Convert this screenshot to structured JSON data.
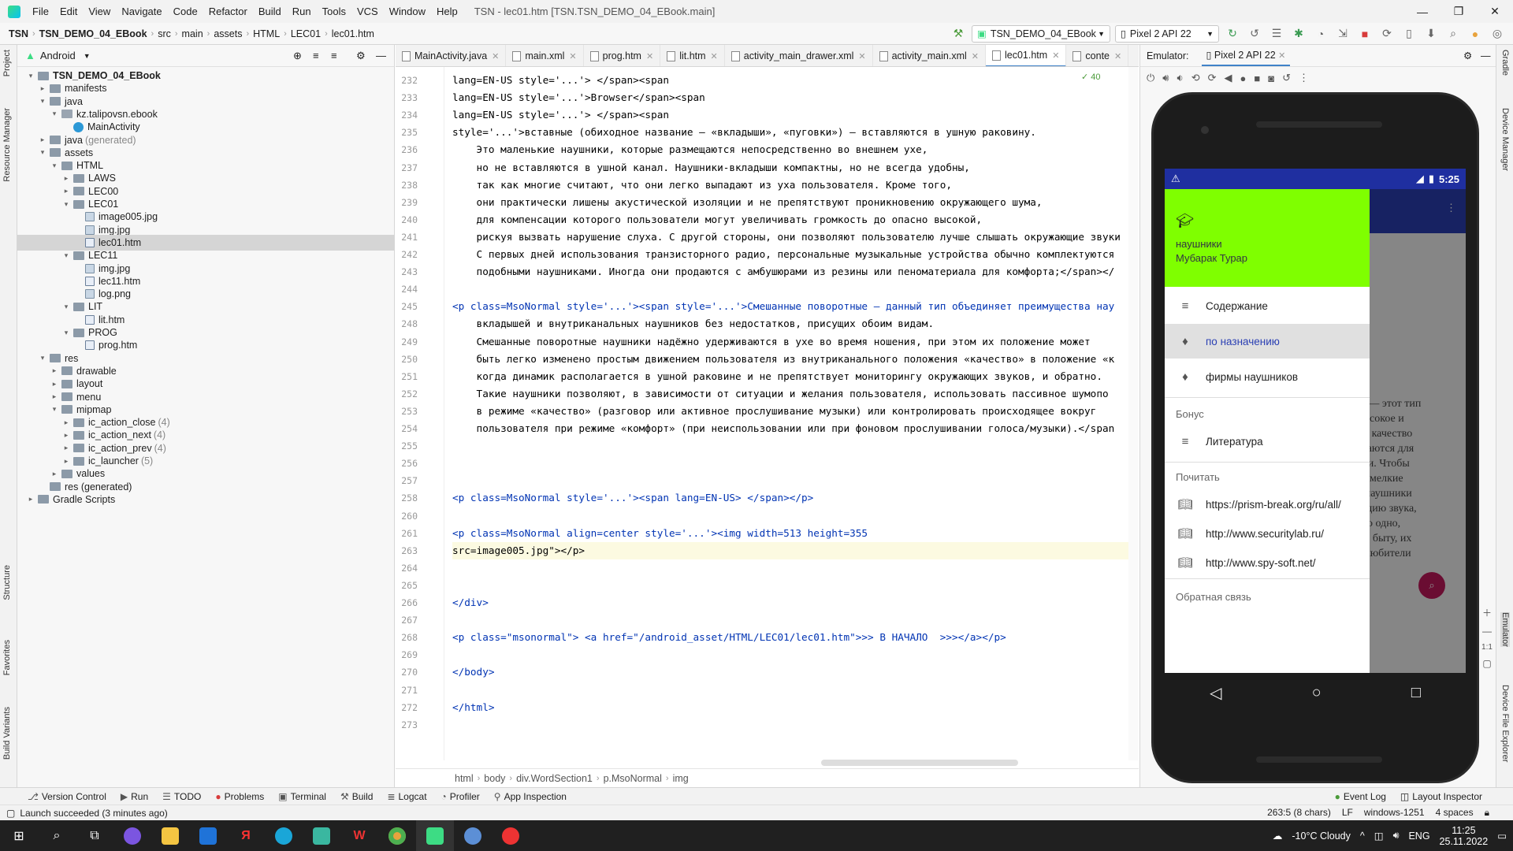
{
  "menubar": {
    "items": [
      "File",
      "Edit",
      "View",
      "Navigate",
      "Code",
      "Refactor",
      "Build",
      "Run",
      "Tools",
      "VCS",
      "Window",
      "Help"
    ],
    "title": "TSN - lec01.htm [TSN.TSN_DEMO_04_EBook.main]"
  },
  "nav": {
    "crumbs": [
      "TSN",
      "TSN_DEMO_04_EBook",
      "src",
      "main",
      "assets",
      "HTML",
      "LEC01",
      "lec01.htm"
    ],
    "run_config": "TSN_DEMO_04_EBook",
    "device": "Pixel 2 API 22"
  },
  "project": {
    "view": "Android",
    "tree": [
      {
        "label": "TSN_DEMO_04_EBook",
        "bold": true,
        "indent": 0,
        "arrow": "▾",
        "icon": "fico"
      },
      {
        "label": "manifests",
        "indent": 1,
        "arrow": "▸",
        "icon": "fico"
      },
      {
        "label": "java",
        "indent": 1,
        "arrow": "▾",
        "icon": "fico"
      },
      {
        "label": "kz.talipovsn.ebook",
        "indent": 2,
        "arrow": "▾",
        "icon": "fico pkg"
      },
      {
        "label": "MainActivity",
        "indent": 3,
        "arrow": "",
        "icon": "fico cls"
      },
      {
        "label": "java",
        "sub": "(generated)",
        "indent": 1,
        "arrow": "▸",
        "icon": "fico"
      },
      {
        "label": "assets",
        "indent": 1,
        "arrow": "▾",
        "icon": "fico"
      },
      {
        "label": "HTML",
        "indent": 2,
        "arrow": "▾",
        "icon": "fico"
      },
      {
        "label": "LAWS",
        "indent": 3,
        "arrow": "▸",
        "icon": "fico"
      },
      {
        "label": "LEC00",
        "indent": 3,
        "arrow": "▸",
        "icon": "fico"
      },
      {
        "label": "LEC01",
        "indent": 3,
        "arrow": "▾",
        "icon": "fico"
      },
      {
        "label": "image005.jpg",
        "indent": 4,
        "arrow": "",
        "icon": "fico img"
      },
      {
        "label": "img.jpg",
        "indent": 4,
        "arrow": "",
        "icon": "fico img"
      },
      {
        "label": "lec01.htm",
        "indent": 4,
        "arrow": "",
        "icon": "fico htm",
        "sel": true
      },
      {
        "label": "LEC11",
        "indent": 3,
        "arrow": "▾",
        "icon": "fico"
      },
      {
        "label": "img.jpg",
        "indent": 4,
        "arrow": "",
        "icon": "fico img"
      },
      {
        "label": "lec11.htm",
        "indent": 4,
        "arrow": "",
        "icon": "fico htm"
      },
      {
        "label": "log.png",
        "indent": 4,
        "arrow": "",
        "icon": "fico img"
      },
      {
        "label": "LIT",
        "indent": 3,
        "arrow": "▾",
        "icon": "fico"
      },
      {
        "label": "lit.htm",
        "indent": 4,
        "arrow": "",
        "icon": "fico htm"
      },
      {
        "label": "PROG",
        "indent": 3,
        "arrow": "▾",
        "icon": "fico"
      },
      {
        "label": "prog.htm",
        "indent": 4,
        "arrow": "",
        "icon": "fico htm"
      },
      {
        "label": "res",
        "indent": 1,
        "arrow": "▾",
        "icon": "fico"
      },
      {
        "label": "drawable",
        "indent": 2,
        "arrow": "▸",
        "icon": "fico"
      },
      {
        "label": "layout",
        "indent": 2,
        "arrow": "▸",
        "icon": "fico"
      },
      {
        "label": "menu",
        "indent": 2,
        "arrow": "▸",
        "icon": "fico"
      },
      {
        "label": "mipmap",
        "indent": 2,
        "arrow": "▾",
        "icon": "fico"
      },
      {
        "label": "ic_action_close",
        "sub": "(4)",
        "indent": 3,
        "arrow": "▸",
        "icon": "fico"
      },
      {
        "label": "ic_action_next",
        "sub": "(4)",
        "indent": 3,
        "arrow": "▸",
        "icon": "fico"
      },
      {
        "label": "ic_action_prev",
        "sub": "(4)",
        "indent": 3,
        "arrow": "▸",
        "icon": "fico"
      },
      {
        "label": "ic_launcher",
        "sub": "(5)",
        "indent": 3,
        "arrow": "▸",
        "icon": "fico"
      },
      {
        "label": "values",
        "indent": 2,
        "arrow": "▸",
        "icon": "fico"
      },
      {
        "label": "res (generated)",
        "indent": 1,
        "arrow": "",
        "icon": "fico"
      },
      {
        "label": "Gradle Scripts",
        "indent": 0,
        "arrow": "▸",
        "icon": "fico"
      }
    ]
  },
  "tabs": [
    "MainActivity.java",
    "main.xml",
    "prog.htm",
    "lit.htm",
    "activity_main_drawer.xml",
    "activity_main.xml",
    "lec01.htm",
    "conte"
  ],
  "active_tab": "lec01.htm",
  "code": [
    {
      "n": "232",
      "t": "lang=EN-US style='...'> </span><span"
    },
    {
      "n": "233",
      "t": "lang=EN-US style='...'>Browser</span><span"
    },
    {
      "n": "234",
      "t": "lang=EN-US style='...'> </span><span"
    },
    {
      "n": "235",
      "t": "style='...'>вставные (обиходное название — «вкладыши», «пуговки») — вставляются в ушную раковину."
    },
    {
      "n": "236",
      "t": "    Это маленькие наушники, которые размещаются непосредственно во внешнем ухе,"
    },
    {
      "n": "237",
      "t": "    но не вставляются в ушной канал. Наушники-вкладыши компактны, но не всегда удобны,"
    },
    {
      "n": "238",
      "t": "    так как многие считают, что они легко выпадают из уха пользователя. Кроме того,"
    },
    {
      "n": "239",
      "t": "    они практически лишены акустической изоляции и не препятствуют проникновению окружающего шума,"
    },
    {
      "n": "240",
      "t": "    для компенсации которого пользователи могут увеличивать громкость до опасно высокой,"
    },
    {
      "n": "241",
      "t": "    рискуя вызвать нарушение слуха. С другой стороны, они позволяют пользователю лучше слышать окружающие звуки"
    },
    {
      "n": "242",
      "t": "    С первых дней использования транзисторного радио, персональные музыкальные устройства обычно комплектуются"
    },
    {
      "n": "243",
      "t": "    подобными наушниками. Иногда они продаются с амбушюрами из резины или пеноматериала для комфорта;</span></"
    },
    {
      "n": "244",
      "t": ""
    },
    {
      "n": "245",
      "t": "<p class=MsoNormal style='...'><span style='...'>Смешанные поворотные — данный тип объединяет преимущества нау"
    },
    {
      "n": "248",
      "t": "    вкладышей и внутриканальных наушников без недостатков, присущих обоим видам."
    },
    {
      "n": "249",
      "t": "    Смешанные поворотные наушники надёжно удерживаются в ухе во время ношения, при этом их положение может"
    },
    {
      "n": "250",
      "t": "    быть легко изменено простым движением пользователя из внутриканального положения «качество» в положение «к"
    },
    {
      "n": "251",
      "t": "    когда динамик располагается в ушной раковине и не препятствует мониторингу окружающих звуков, и обратно."
    },
    {
      "n": "252",
      "t": "    Такие наушники позволяют, в зависимости от ситуации и желания пользователя, использовать пассивное шумопо"
    },
    {
      "n": "253",
      "t": "    в режиме «качество» (разговор или активное прослушивание музыки) или контролировать происходящее вокруг"
    },
    {
      "n": "254",
      "t": "    пользователя при режиме «комфорт» (при неиспользовании или при фоновом прослушивании голоса/музыки).</span"
    },
    {
      "n": "255",
      "t": ""
    },
    {
      "n": "256",
      "t": ""
    },
    {
      "n": "257",
      "t": ""
    },
    {
      "n": "258",
      "t": "<p class=MsoNormal style='...'><span lang=EN-US> </span></p>"
    },
    {
      "n": "260",
      "t": ""
    },
    {
      "n": "261",
      "t": "<p class=MsoNormal align=center style='...'><img width=513 height=355"
    },
    {
      "n": "263",
      "t": "src=image005.jpg\"></p>"
    },
    {
      "n": "264",
      "t": ""
    },
    {
      "n": "265",
      "t": ""
    },
    {
      "n": "266",
      "t": "</div>"
    },
    {
      "n": "267",
      "t": ""
    },
    {
      "n": "268",
      "t": "<p class=\"msonormal\"> <a href=\"/android_asset/HTML/LEC01/lec01.htm\">>> В НАЧАЛО  >>></a></p>"
    },
    {
      "n": "269",
      "t": ""
    },
    {
      "n": "270",
      "t": "</body>"
    },
    {
      "n": "271",
      "t": ""
    },
    {
      "n": "272",
      "t": "</html>"
    },
    {
      "n": "273",
      "t": ""
    }
  ],
  "inspection_count": "40",
  "editor_breadcrumb": [
    "html",
    "body",
    "div.WordSection1",
    "p.MsoNormal",
    "img"
  ],
  "emulator": {
    "label": "Emulator:",
    "tab": "Pixel 2 API 22",
    "clock": "5:25",
    "drawer": {
      "title": "наушники",
      "subtitle": "Мубарак Турар",
      "items": [
        {
          "label": "Содержание",
          "icon": "≡",
          "active": false
        },
        {
          "label": "по назначению",
          "icon": "♦",
          "active": true
        },
        {
          "label": "фирмы наушников",
          "icon": "♦",
          "active": false
        }
      ],
      "cap1": "Бонус",
      "lit": "Литература",
      "cap2": "Почитать",
      "links": [
        "https://prism-break.org/ru/all/",
        "http://www.securitylab.ru/",
        "http://www.spy-soft.net/"
      ],
      "cap3": "Обратная связь"
    },
    "bgtext": [
      "о",
      "е) — этот тип",
      "высокое   и",
      "ам качество",
      "ачаются для",
      "иси. Чтобы",
      "ть  мелкие",
      "е наушники",
      "зацию звука,",
      "что одно,",
      "е в быту, их",
      "е любители"
    ],
    "zoom": "1:1"
  },
  "bottombar": [
    "Version Control",
    "Run",
    "TODO",
    "Problems",
    "Terminal",
    "Build",
    "Logcat",
    "Profiler",
    "App Inspection"
  ],
  "bottom_right": [
    "Event Log",
    "Layout Inspector"
  ],
  "status": {
    "message": "Launch succeeded (3 minutes ago)",
    "position": "263:5 (8 chars)",
    "lf": "LF",
    "encoding": "windows-1251",
    "indent": "4 spaces"
  },
  "taskbar": {
    "weather": "-10°C  Cloudy",
    "lang": "ENG",
    "time": "11:25",
    "date": "25.11.2022"
  },
  "side_tabs": {
    "left": [
      "Project",
      "Resource Manager",
      "Structure",
      "Favorites",
      "Build Variants"
    ],
    "right": [
      "Gradle",
      "Device Manager",
      "Emulator",
      "Device File Explorer"
    ]
  }
}
